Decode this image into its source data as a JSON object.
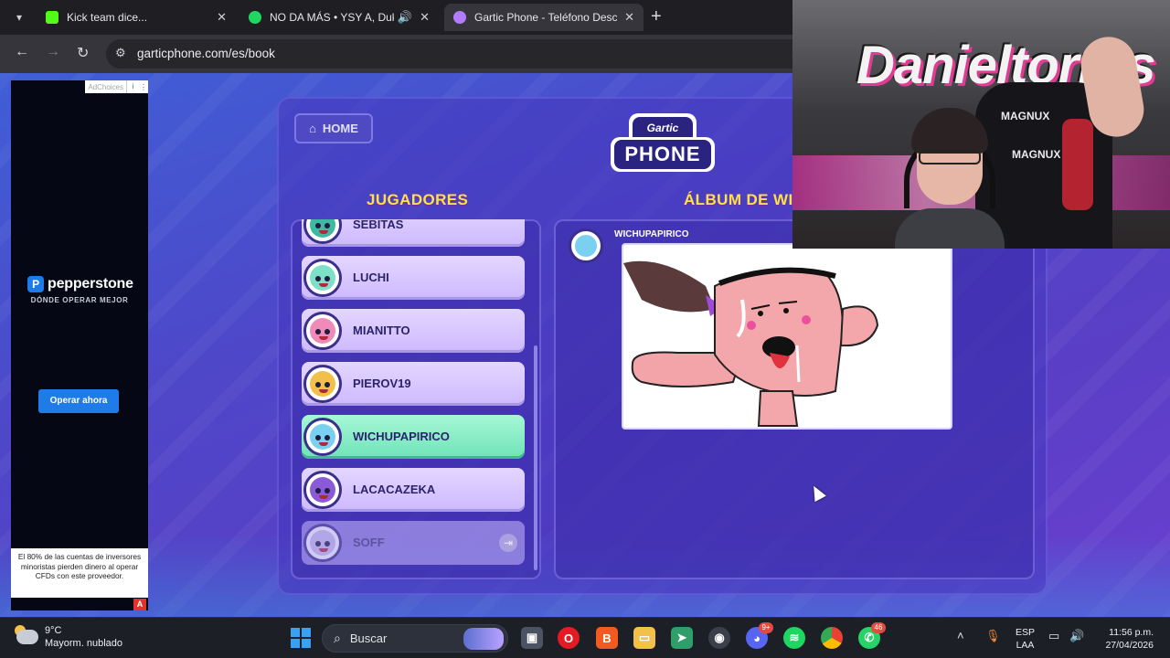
{
  "browser": {
    "tabs": [
      {
        "title": "Kick team dice...",
        "favicon_color": "#53fc18",
        "active": false
      },
      {
        "title": "NO DA MÁS • YSY A, Duki,",
        "favicon_color": "#1ed760",
        "active": false
      },
      {
        "title": "Gartic Phone - Teléfono Descor",
        "favicon_color": "#b27cff",
        "active": true
      }
    ],
    "new_tab_label": "+",
    "url": "garticphone.com/es/book"
  },
  "ad": {
    "choices_label": "AdChoices",
    "brand": "pepperstone",
    "tagline": "DÓNDE OPERAR MEJOR",
    "cta": "Operar ahora",
    "disclaimer": "El 80% de las cuentas de inversores minoristas pierden dinero al operar CFDs con este proveedor.",
    "badge": "A"
  },
  "game": {
    "home_label": "HOME",
    "logo_top": "Gartic",
    "logo_main": "PHONE",
    "players_title": "JUGADORES",
    "album_title": "ÁLBUM DE WI",
    "players": [
      {
        "name": "SEBITAS",
        "avatar_color": "#3fb9a0",
        "state": "normal"
      },
      {
        "name": "LUCHI",
        "avatar_color": "#7fe0c8",
        "state": "normal"
      },
      {
        "name": "MIANITTO",
        "avatar_color": "#f08ab8",
        "state": "normal"
      },
      {
        "name": "PIEROV19",
        "avatar_color": "#f1c04a",
        "state": "normal"
      },
      {
        "name": "WICHUPAPIRICO",
        "avatar_color": "#7ad0f0",
        "state": "active"
      },
      {
        "name": "LACACAZEKA",
        "avatar_color": "#8a5ad8",
        "state": "normal"
      },
      {
        "name": "SOFF",
        "avatar_color": "#c9c2ef",
        "state": "offline"
      }
    ],
    "album": {
      "author": "WICHUPAPIRICO",
      "author_avatar_color": "#7ad0f0"
    }
  },
  "webcam": {
    "graffiti": "Danieltorres",
    "chair_brand": "MAGNUX"
  },
  "taskbar": {
    "weather_temp": "9°C",
    "weather_desc": "Mayorm. nublado",
    "search_placeholder": "Buscar",
    "discord_badge": "9+",
    "whatsapp_badge": "46",
    "lang_line1": "ESP",
    "lang_line2": "LAA",
    "time": "11:56 p.m.",
    "date": "27/04/2026"
  }
}
